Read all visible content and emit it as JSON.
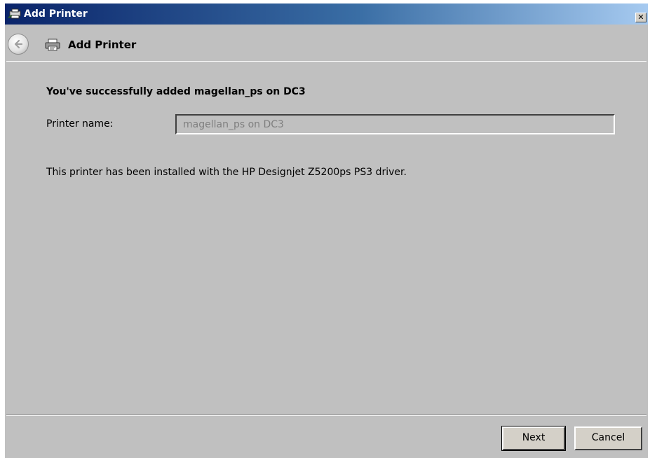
{
  "window": {
    "title": "Add Printer",
    "close_glyph": "✕"
  },
  "header": {
    "title": "Add Printer",
    "back_icon": "back-arrow-icon",
    "printer_icon": "printer-icon"
  },
  "content": {
    "heading": "You've successfully added magellan_ps on DC3",
    "printer_name_label": "Printer name:",
    "printer_name_value": "magellan_ps on DC3",
    "driver_text": "This printer has been installed with the HP Designjet Z5200ps PS3 driver."
  },
  "footer": {
    "next_label": "Next",
    "cancel_label": "Cancel"
  },
  "colors": {
    "window_background": "#c0c0c0",
    "titlebar_start": "#0a246a",
    "titlebar_end": "#a6caf0",
    "disabled_text": "#7f7f7f"
  }
}
